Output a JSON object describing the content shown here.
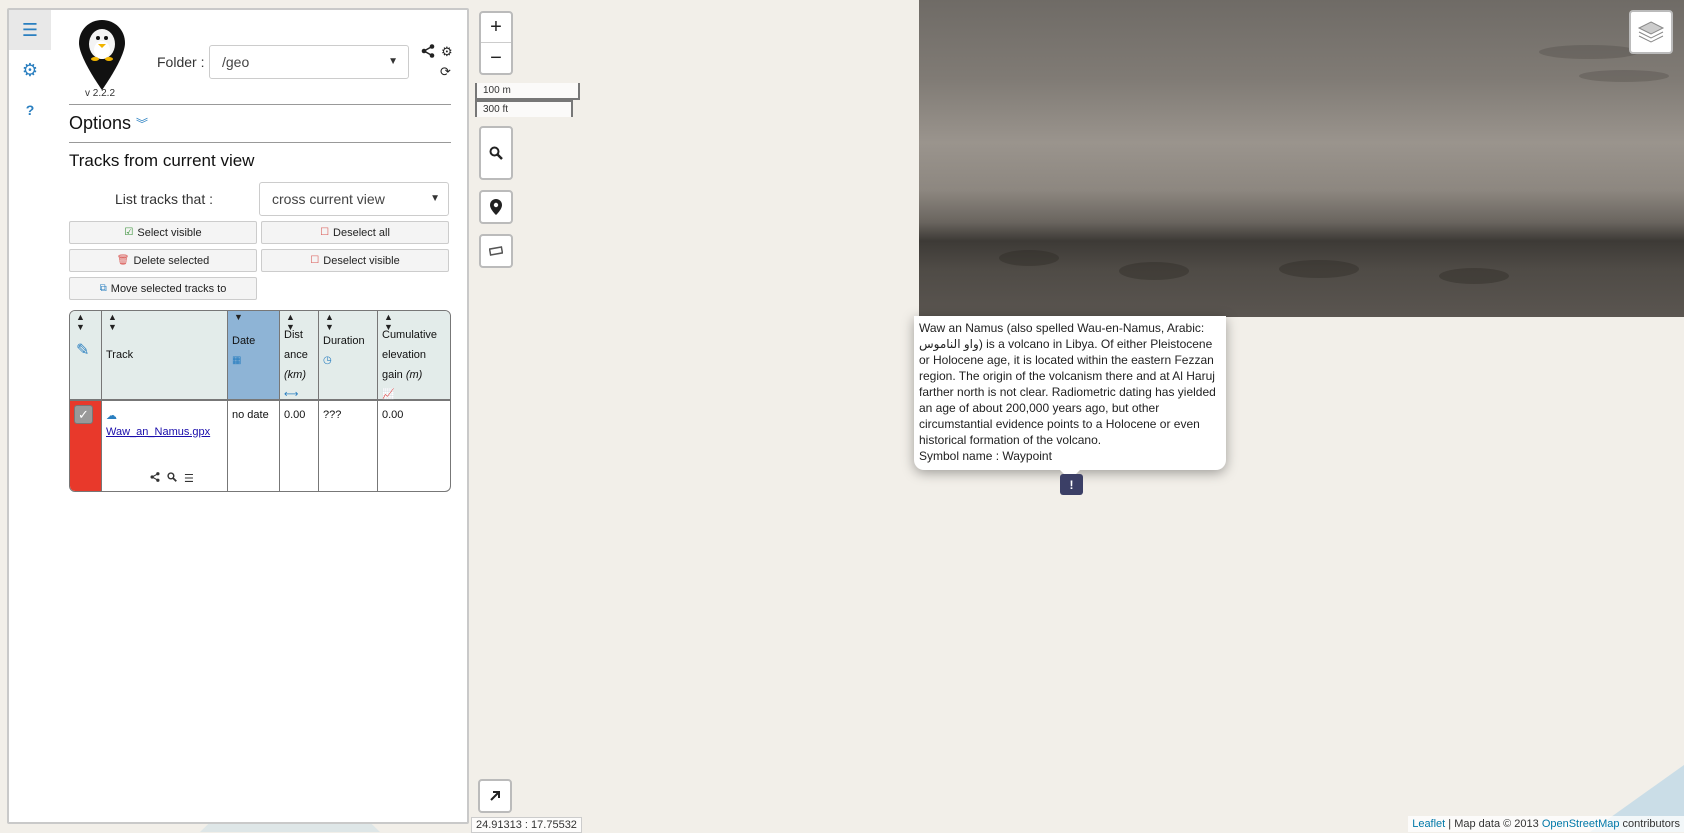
{
  "sidebar": {
    "tabs": [
      {
        "icon": "hamburger-icon",
        "glyph": "☰"
      },
      {
        "icon": "gear-icon",
        "glyph": "⚙"
      },
      {
        "icon": "question-icon",
        "glyph": "?"
      }
    ],
    "version": "v 2.2.2",
    "folder_label": "Folder :",
    "folder_value": "/geo",
    "options_title": "Options",
    "tracks_title": "Tracks from current view",
    "list_label": "List tracks that :",
    "list_value": "cross current view",
    "buttons": {
      "select_visible": "Select visible",
      "deselect_all": "Deselect all",
      "delete_selected": "Delete selected",
      "deselect_visible": "Deselect visible",
      "move_selected": "Move selected tracks to"
    },
    "table": {
      "headers": {
        "track": "Track",
        "date": "Date",
        "distance_a": "Dist",
        "distance_b": "ance",
        "distance_unit": "(km)",
        "duration": "Duration",
        "elevation_a": "Cumulative",
        "elevation_b": "elevation",
        "elevation_c": "gain",
        "elevation_unit": "(m)"
      },
      "rows": [
        {
          "name": "Waw_an_Namus.gpx",
          "date": "no date",
          "distance": "0.00",
          "duration": "???",
          "elevation": "0.00"
        }
      ]
    }
  },
  "map": {
    "scale_metric": "100 m",
    "scale_imperial": "300 ft",
    "coords": "24.91313 : 17.75532",
    "popup_text": "Waw an Namus (also spelled Wau-en-Namus, Arabic: واو الناموس) is a volcano in Libya. Of either Pleistocene or Holocene age, it is located within the eastern Fezzan region. The origin of the volcanism there and at Al Haruj farther north is not clear. Radiometric dating has yielded an age of about 200,000 years ago, but other circumstantial evidence points to a Holocene or even historical formation of the volcano.",
    "popup_symbol": "Symbol name : Waypoint",
    "attribution_leaflet": "Leaflet",
    "attribution_middle": " | Map data © 2013 ",
    "attribution_osm": "OpenStreetMap",
    "attribution_end": " contributors"
  },
  "colors": {
    "accent": "#2a7fc0",
    "selected_row": "#e8392b",
    "sorted_header": "#8eb4d6"
  }
}
